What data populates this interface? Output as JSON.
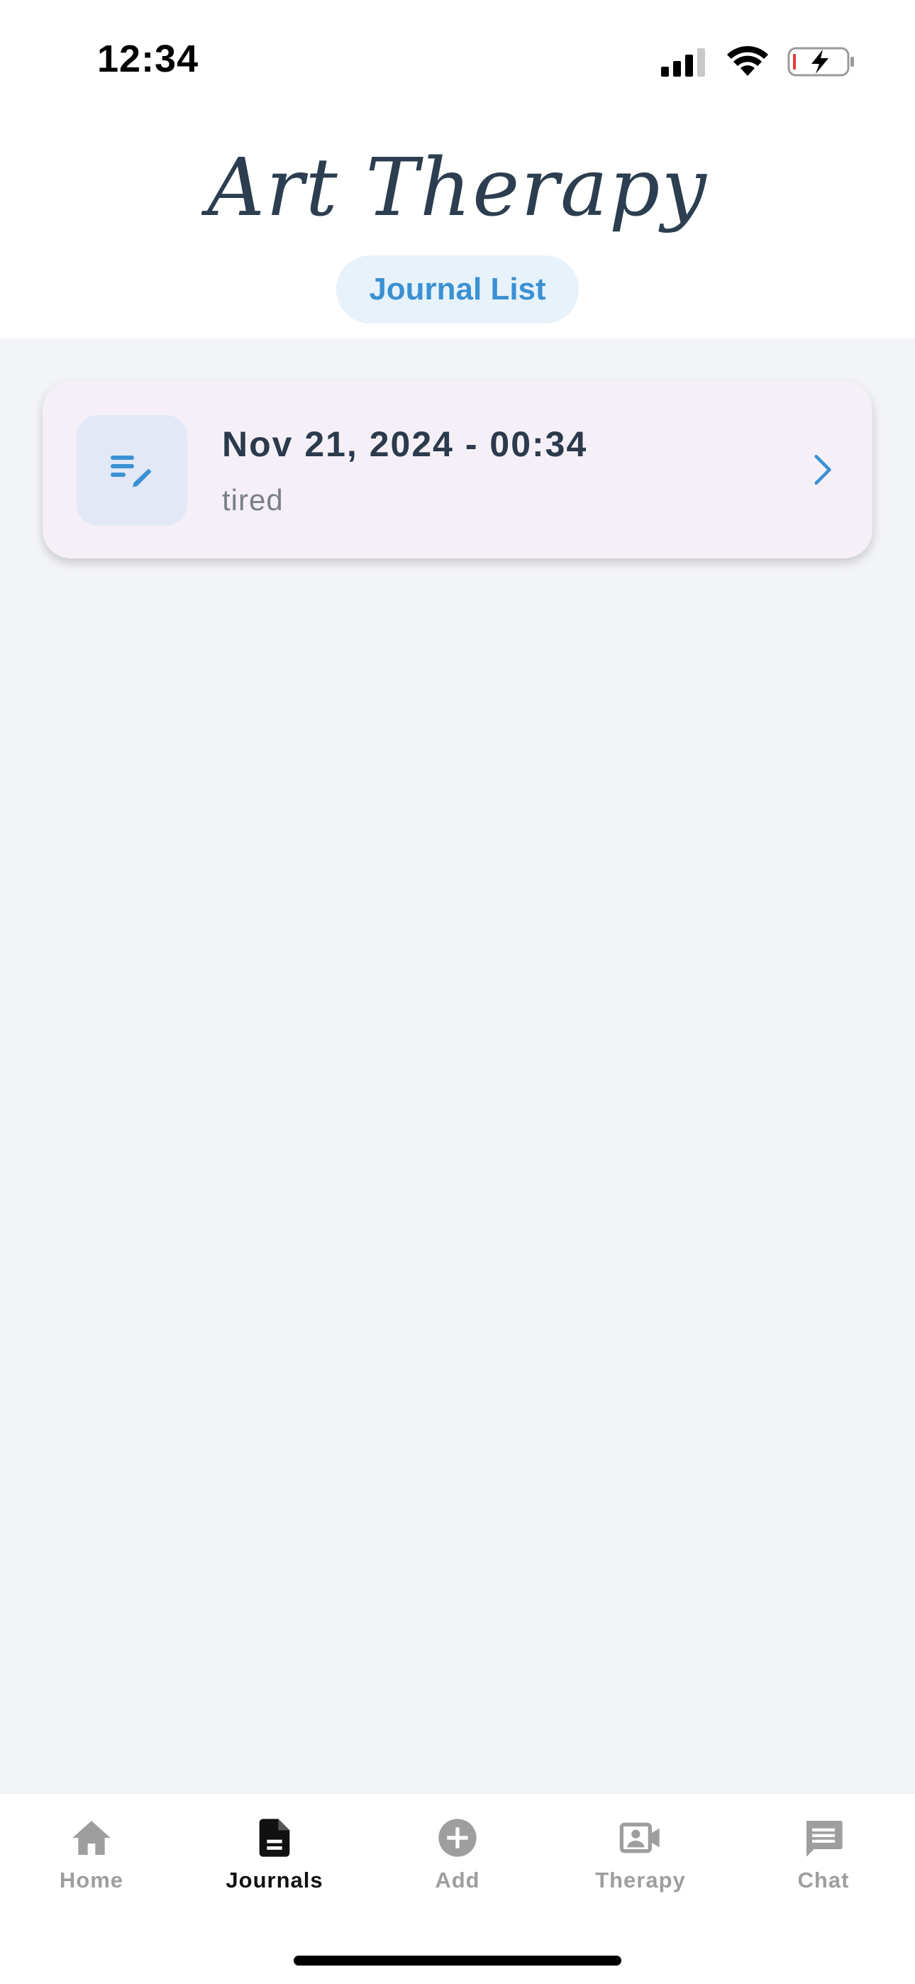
{
  "status_bar": {
    "time": "12:34"
  },
  "header": {
    "app_title": "Art Therapy",
    "chip_label": "Journal List"
  },
  "journals": [
    {
      "date": "Nov 21, 2024 - 00:34",
      "mood": "tired",
      "icon": "edit-note-icon"
    }
  ],
  "bottom_nav": {
    "items": [
      {
        "label": "Home",
        "icon": "home-icon",
        "active": false
      },
      {
        "label": "Journals",
        "icon": "document-icon",
        "active": true
      },
      {
        "label": "Add",
        "icon": "add-circle-icon",
        "active": false
      },
      {
        "label": "Therapy",
        "icon": "video-contact-icon",
        "active": false
      },
      {
        "label": "Chat",
        "icon": "chat-icon",
        "active": false
      }
    ]
  },
  "colors": {
    "accent": "#3a91d3",
    "title": "#2c3e50",
    "card_bg": "#f5f0f7",
    "page_bg": "#f3f4f7",
    "nav_inactive": "#9e9e9e",
    "nav_active": "#111111"
  }
}
